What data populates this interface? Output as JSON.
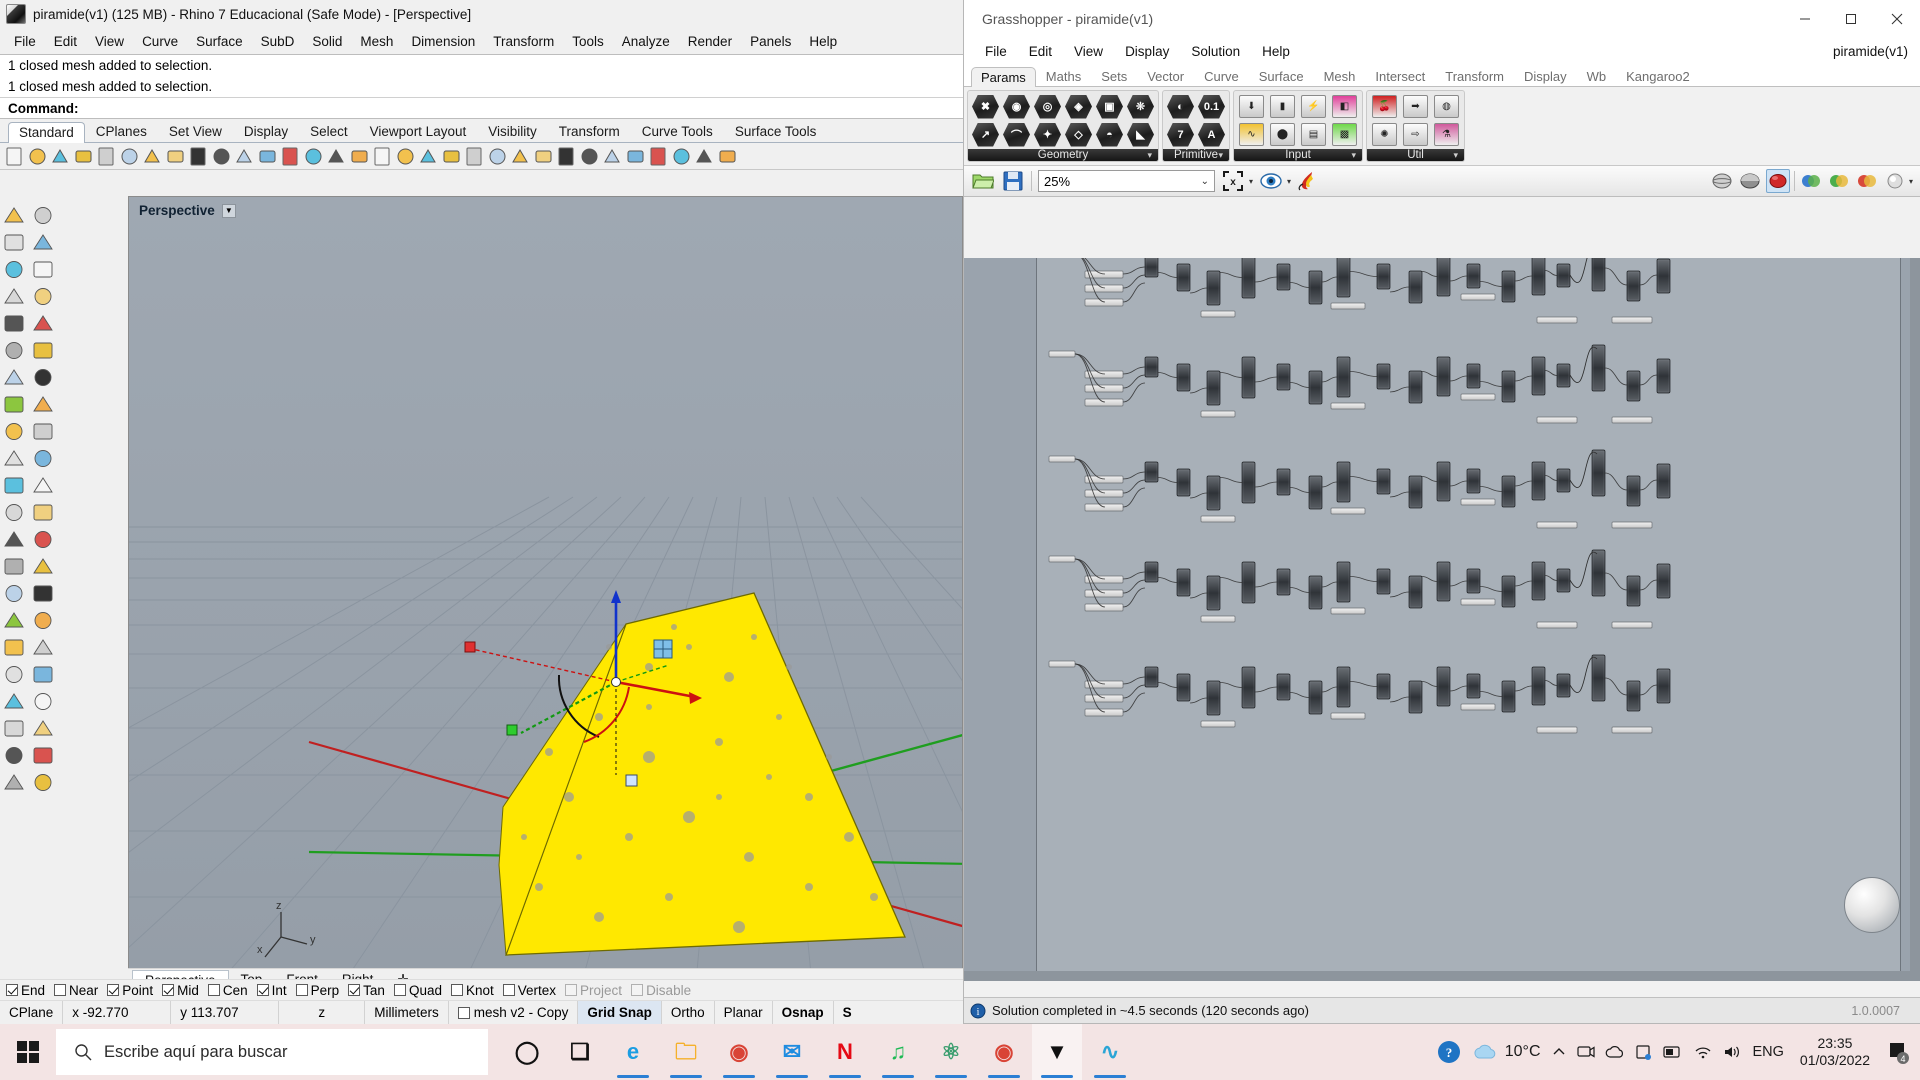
{
  "rhino": {
    "title": "piramide(v1) (125 MB) - Rhino 7 Educacional (Safe Mode) - [Perspective]",
    "menu": [
      "File",
      "Edit",
      "View",
      "Curve",
      "Surface",
      "SubD",
      "Solid",
      "Mesh",
      "Dimension",
      "Transform",
      "Tools",
      "Analyze",
      "Render",
      "Panels",
      "Help"
    ],
    "command_history": [
      "1 closed mesh added to selection.",
      "1 closed mesh added to selection."
    ],
    "command_prompt": "Command:",
    "toolbar_tabs": [
      "Standard",
      "CPlanes",
      "Set View",
      "Display",
      "Select",
      "Viewport Layout",
      "Visibility",
      "Transform",
      "Curve Tools",
      "Surface Tools"
    ],
    "active_toolbar_tab": "Standard",
    "viewport": {
      "label": "Perspective"
    },
    "viewport_tabs": [
      "Perspective",
      "Top",
      "Front",
      "Right"
    ],
    "active_viewport_tab": "Perspective",
    "osnap": [
      {
        "label": "End",
        "checked": true,
        "disabled": false
      },
      {
        "label": "Near",
        "checked": false,
        "disabled": false
      },
      {
        "label": "Point",
        "checked": true,
        "disabled": false
      },
      {
        "label": "Mid",
        "checked": true,
        "disabled": false
      },
      {
        "label": "Cen",
        "checked": false,
        "disabled": false
      },
      {
        "label": "Int",
        "checked": true,
        "disabled": false
      },
      {
        "label": "Perp",
        "checked": false,
        "disabled": false
      },
      {
        "label": "Tan",
        "checked": true,
        "disabled": false
      },
      {
        "label": "Quad",
        "checked": false,
        "disabled": false
      },
      {
        "label": "Knot",
        "checked": false,
        "disabled": false
      },
      {
        "label": "Vertex",
        "checked": false,
        "disabled": false
      },
      {
        "label": "Project",
        "checked": false,
        "disabled": true
      },
      {
        "label": "Disable",
        "checked": false,
        "disabled": true
      }
    ],
    "status": {
      "cplane": "CPlane",
      "x": "x -92.770",
      "y": "y 113.707",
      "z": "z",
      "units": "Millimeters",
      "layer": "mesh v2 - Copy",
      "grid_snap": "Grid Snap",
      "ortho": "Ortho",
      "planar": "Planar",
      "osnap": "Osnap",
      "smart": "S"
    }
  },
  "grasshopper": {
    "title": "Grasshopper - piramide(v1)",
    "menu": [
      "File",
      "Edit",
      "View",
      "Display",
      "Solution",
      "Help"
    ],
    "document_name": "piramide(v1)",
    "tabs": [
      "Params",
      "Maths",
      "Sets",
      "Vector",
      "Curve",
      "Surface",
      "Mesh",
      "Intersect",
      "Transform",
      "Display",
      "Wb",
      "Kangaroo2"
    ],
    "active_tab": "Params",
    "ribbon_groups": [
      {
        "label": "Geometry",
        "components": [
          {
            "icon": "geometry-null-icon",
            "glyph": "✖",
            "shape": "hex"
          },
          {
            "icon": "vector-arrow-icon",
            "glyph": "↗",
            "shape": "hex"
          },
          {
            "icon": "circle-param-icon",
            "glyph": "◉",
            "shape": "hex"
          },
          {
            "icon": "curve-param-icon",
            "glyph": "⌒",
            "shape": "hex"
          },
          {
            "icon": "surface-param-icon",
            "glyph": "◎",
            "shape": "hex"
          },
          {
            "icon": "geometry-pipe-icon",
            "glyph": "✦",
            "shape": "hex"
          },
          {
            "icon": "mesh-face-icon",
            "glyph": "◈",
            "shape": "hex"
          },
          {
            "icon": "plane-param-icon",
            "glyph": "◇",
            "shape": "hex"
          },
          {
            "icon": "box-param-icon",
            "glyph": "▣",
            "shape": "hex"
          },
          {
            "icon": "brep-param-icon",
            "glyph": "◓",
            "shape": "hex"
          },
          {
            "icon": "mesh-param-icon",
            "glyph": "❊",
            "shape": "hex"
          },
          {
            "icon": "subd-param-icon",
            "glyph": "◣",
            "shape": "hex"
          }
        ]
      },
      {
        "label": "Primitive",
        "components": [
          {
            "icon": "boolean-param-icon",
            "glyph": "◐",
            "shape": "hex"
          },
          {
            "icon": "integer-param-icon",
            "glyph": "7",
            "shape": "hex"
          },
          {
            "icon": "number-param-icon",
            "glyph": "0.1",
            "shape": "hex"
          },
          {
            "icon": "text-param-icon",
            "glyph": "A",
            "shape": "hex"
          }
        ]
      },
      {
        "label": "Input",
        "components": [
          {
            "icon": "file-reader-icon",
            "glyph": "⬇",
            "shape": "sq"
          },
          {
            "icon": "graph-mapper-icon",
            "glyph": "∿",
            "shape": "sq",
            "color": "#f2c230"
          },
          {
            "icon": "button-input-icon",
            "glyph": "▮",
            "shape": "sq"
          },
          {
            "icon": "knob-input-icon",
            "glyph": "⬤",
            "shape": "sq"
          },
          {
            "icon": "value-list-icon",
            "glyph": "⚡",
            "shape": "sq"
          },
          {
            "icon": "panel-input-icon",
            "glyph": "▤",
            "shape": "sq"
          },
          {
            "icon": "colour-picker-icon",
            "glyph": "◧",
            "shape": "sq",
            "color": "#e0409a"
          },
          {
            "icon": "gradient-input-icon",
            "glyph": "▩",
            "shape": "sq",
            "color": "#6fd84a"
          }
        ]
      },
      {
        "label": "Util",
        "components": [
          {
            "icon": "cherry-picker-icon",
            "glyph": "🍒",
            "shape": "sq",
            "color": "#cf2020"
          },
          {
            "icon": "data-tree-icon",
            "glyph": "✺",
            "shape": "sq"
          },
          {
            "icon": "relay-right-icon",
            "glyph": "➡",
            "shape": "sq"
          },
          {
            "icon": "relay-out-icon",
            "glyph": "⇨",
            "shape": "sq"
          },
          {
            "icon": "jump-in-icon",
            "glyph": "◍",
            "shape": "sq"
          },
          {
            "icon": "flask-icon",
            "glyph": "⚗",
            "shape": "sq",
            "color": "#d05a9c"
          }
        ]
      }
    ],
    "canvas_toolbar": {
      "open_icon": "open-file-icon",
      "save_icon": "save-file-icon",
      "zoom_value": "25%",
      "zoom_extents_icon": "zoom-extents-icon",
      "preview_icon": "preview-eye-icon",
      "bake_icon": "bake-flame-icon",
      "right_icons": [
        "sphere-preview-icon",
        "shaded-preview-icon",
        "red-ball-icon",
        "colour-swatch-1-icon",
        "colour-swatch-2-icon",
        "colour-swatch-3-icon",
        "colour-swatch-4-icon"
      ]
    },
    "status_bar": {
      "icon": "info-icon",
      "message": "Solution completed in ~4.5 seconds (120 seconds ago)",
      "version": "1.0.0007"
    }
  },
  "taskbar": {
    "search_placeholder": "Escribe aquí para buscar",
    "start_icon": "windows-start-icon",
    "search_icon": "search-icon",
    "apps": [
      {
        "name": "cortana-icon",
        "glyph": "◯",
        "color": "#111"
      },
      {
        "name": "task-view-icon",
        "glyph": "❏",
        "color": "#111"
      },
      {
        "name": "microsoft-edge-icon",
        "glyph": "e",
        "color": "#1b9de2"
      },
      {
        "name": "file-explorer-icon",
        "glyph": "🗀",
        "color": "#f5b12c"
      },
      {
        "name": "google-chrome-icon",
        "glyph": "◉",
        "color": "#d94436"
      },
      {
        "name": "mail-icon",
        "glyph": "✉",
        "color": "#1f8ce0"
      },
      {
        "name": "netflix-icon",
        "glyph": "N",
        "color": "#e50914"
      },
      {
        "name": "spotify-icon",
        "glyph": "♫",
        "color": "#1db954"
      },
      {
        "name": "atom-icon",
        "glyph": "⚛",
        "color": "#3a9d6e"
      },
      {
        "name": "chrome-profile-icon",
        "glyph": "◉",
        "color": "#d94436"
      },
      {
        "name": "rhino-icon",
        "glyph": "▼",
        "color": "#111"
      },
      {
        "name": "grasshopper-icon",
        "glyph": "∿",
        "color": "#2aa5d6"
      }
    ],
    "tray": {
      "help_icon": "help-circle-icon",
      "weather_icon": "cloud-icon",
      "temperature": "10°C",
      "chevron_icon": "chevron-up-icon",
      "onedrive_icon": "onedrive-icon",
      "dropbox_icon": "dropbox-icon",
      "monitor_icon": "monitor-icon",
      "battery_icon": "battery-icon",
      "wifi_icon": "wifi-icon",
      "volume_icon": "volume-icon",
      "language": "ENG",
      "time": "23:35",
      "date": "01/03/2022",
      "notifications_icon": "notifications-icon",
      "notifications_count": "4"
    }
  }
}
